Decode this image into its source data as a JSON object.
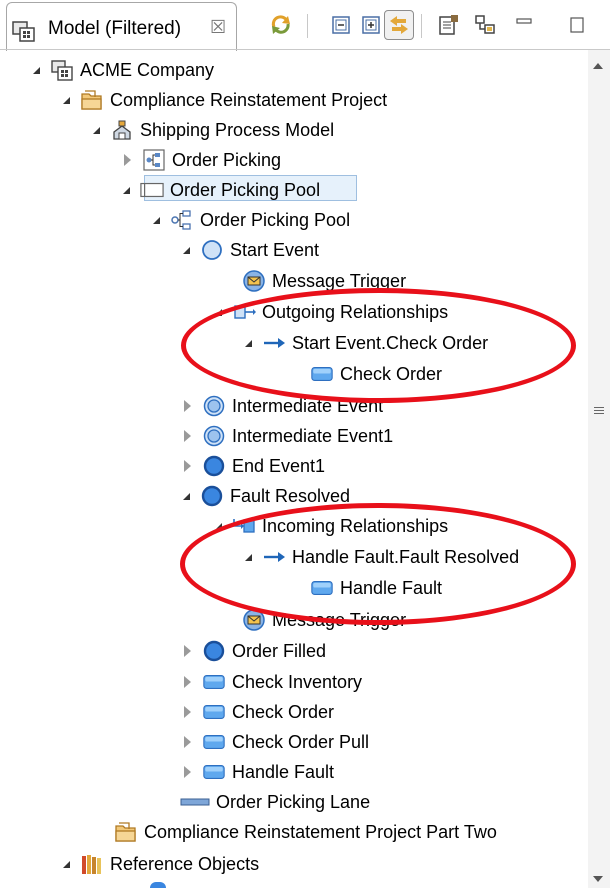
{
  "view": {
    "title": "Model (Filtered)",
    "close_glyph": "☒"
  },
  "toolbar": {
    "items": [
      {
        "name": "sync-icon",
        "pressed": false
      },
      {
        "name": "collapse-all-icon",
        "pressed": false
      },
      {
        "name": "expand-all-icon",
        "pressed": false
      },
      {
        "name": "link-with-editor-icon",
        "pressed": true
      },
      {
        "name": "properties-icon",
        "pressed": false
      },
      {
        "name": "filters-icon",
        "pressed": false
      },
      {
        "name": "minimize-icon",
        "pressed": false
      },
      {
        "name": "maximize-icon",
        "pressed": false
      }
    ]
  },
  "tree": {
    "rows": [
      {
        "label": "ACME Company",
        "icon": "model-icon",
        "state": "expanded"
      },
      {
        "label": "Compliance Reinstatement Project",
        "icon": "project-folder-icon",
        "state": "expanded"
      },
      {
        "label": "Shipping Process Model",
        "icon": "process-model-icon",
        "state": "expanded"
      },
      {
        "label": "Order Picking",
        "icon": "diagram-icon",
        "state": "collapsed"
      },
      {
        "label": "Order Picking Pool",
        "icon": "pool-icon",
        "state": "expanded",
        "selected": true
      },
      {
        "label": "Order Picking Pool",
        "icon": "process-icon",
        "state": "expanded"
      },
      {
        "label": "Start Event",
        "icon": "start-event-icon",
        "state": "expanded"
      },
      {
        "label": "Message Trigger",
        "icon": "message-trigger-icon",
        "state": "leaf"
      },
      {
        "label": "Outgoing Relationships",
        "icon": "outgoing-relationships-icon",
        "state": "expanded"
      },
      {
        "label": "Start Event.Check Order",
        "icon": "relationship-arrow-icon",
        "state": "expanded"
      },
      {
        "label": "Check Order",
        "icon": "task-icon",
        "state": "leaf"
      },
      {
        "label": "Intermediate Event",
        "icon": "intermediate-event-icon",
        "state": "collapsed"
      },
      {
        "label": "Intermediate Event1",
        "icon": "intermediate-event-icon",
        "state": "collapsed"
      },
      {
        "label": "End Event1",
        "icon": "end-event-icon",
        "state": "collapsed"
      },
      {
        "label": "Fault Resolved",
        "icon": "end-event-icon",
        "state": "expanded"
      },
      {
        "label": "Incoming Relationships",
        "icon": "incoming-relationships-icon",
        "state": "expanded"
      },
      {
        "label": "Handle Fault.Fault Resolved",
        "icon": "relationship-arrow-icon",
        "state": "expanded"
      },
      {
        "label": "Handle Fault",
        "icon": "task-icon",
        "state": "leaf"
      },
      {
        "label": "Message Trigger",
        "icon": "message-trigger-icon",
        "state": "leaf"
      },
      {
        "label": "Order Filled",
        "icon": "end-event-icon",
        "state": "collapsed"
      },
      {
        "label": "Check Inventory",
        "icon": "task-icon",
        "state": "collapsed"
      },
      {
        "label": "Check Order",
        "icon": "task-icon",
        "state": "collapsed"
      },
      {
        "label": "Check Order Pull",
        "icon": "task-icon",
        "state": "collapsed"
      },
      {
        "label": "Handle Fault",
        "icon": "task-icon",
        "state": "collapsed"
      },
      {
        "label": "Order Picking Lane",
        "icon": "lane-icon",
        "state": "leaf"
      },
      {
        "label": "Compliance Reinstatement Project Part Two",
        "icon": "project-folder-icon",
        "state": "leaf"
      },
      {
        "label": "Reference Objects",
        "icon": "library-icon",
        "state": "expanded"
      }
    ]
  },
  "colors": {
    "annotation": "#e8101a",
    "selection_fill": "#e6f1fb",
    "selection_border": "#9fbfe0",
    "event_blue": "#2e7bd6",
    "task_blue": "#3f8fe0"
  }
}
